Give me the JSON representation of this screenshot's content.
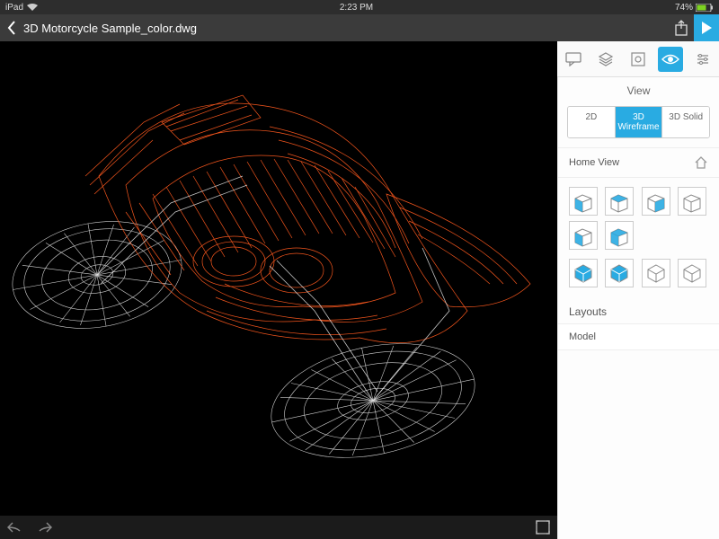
{
  "status": {
    "device": "iPad",
    "time": "2:23 PM",
    "battery": "74%"
  },
  "header": {
    "filename": "3D Motorcycle Sample_color.dwg"
  },
  "toolbar": {
    "icons": [
      "comment-icon",
      "layers-icon",
      "properties-icon",
      "view-icon",
      "settings-icon"
    ],
    "active_index": 3
  },
  "view_panel": {
    "title": "View",
    "modes": [
      "2D",
      "3D Wireframe",
      "3D Solid"
    ],
    "active_mode_index": 1,
    "home_label": "Home View",
    "layouts_label": "Layouts",
    "layouts": [
      "Model"
    ],
    "face_views": [
      {
        "name": "front",
        "fills": [
          "front"
        ]
      },
      {
        "name": "top",
        "fills": [
          "top"
        ]
      },
      {
        "name": "right",
        "fills": [
          "right"
        ]
      },
      {
        "name": "back",
        "fills": []
      },
      {
        "name": "left",
        "fills": [
          "front"
        ]
      },
      {
        "name": "bottom",
        "fills": [
          "top",
          "front"
        ]
      },
      {
        "name": "iso1",
        "fills": []
      },
      {
        "name": "iso2",
        "fills": []
      }
    ],
    "iso_views": [
      {
        "name": "sw",
        "fill": true
      },
      {
        "name": "se",
        "fill": true
      },
      {
        "name": "ne",
        "fill": false
      },
      {
        "name": "nw",
        "fill": false
      }
    ]
  },
  "colors": {
    "accent": "#29abe2",
    "wire_body": "#ff5a1f",
    "wire_frame": "#e8e8e8"
  }
}
